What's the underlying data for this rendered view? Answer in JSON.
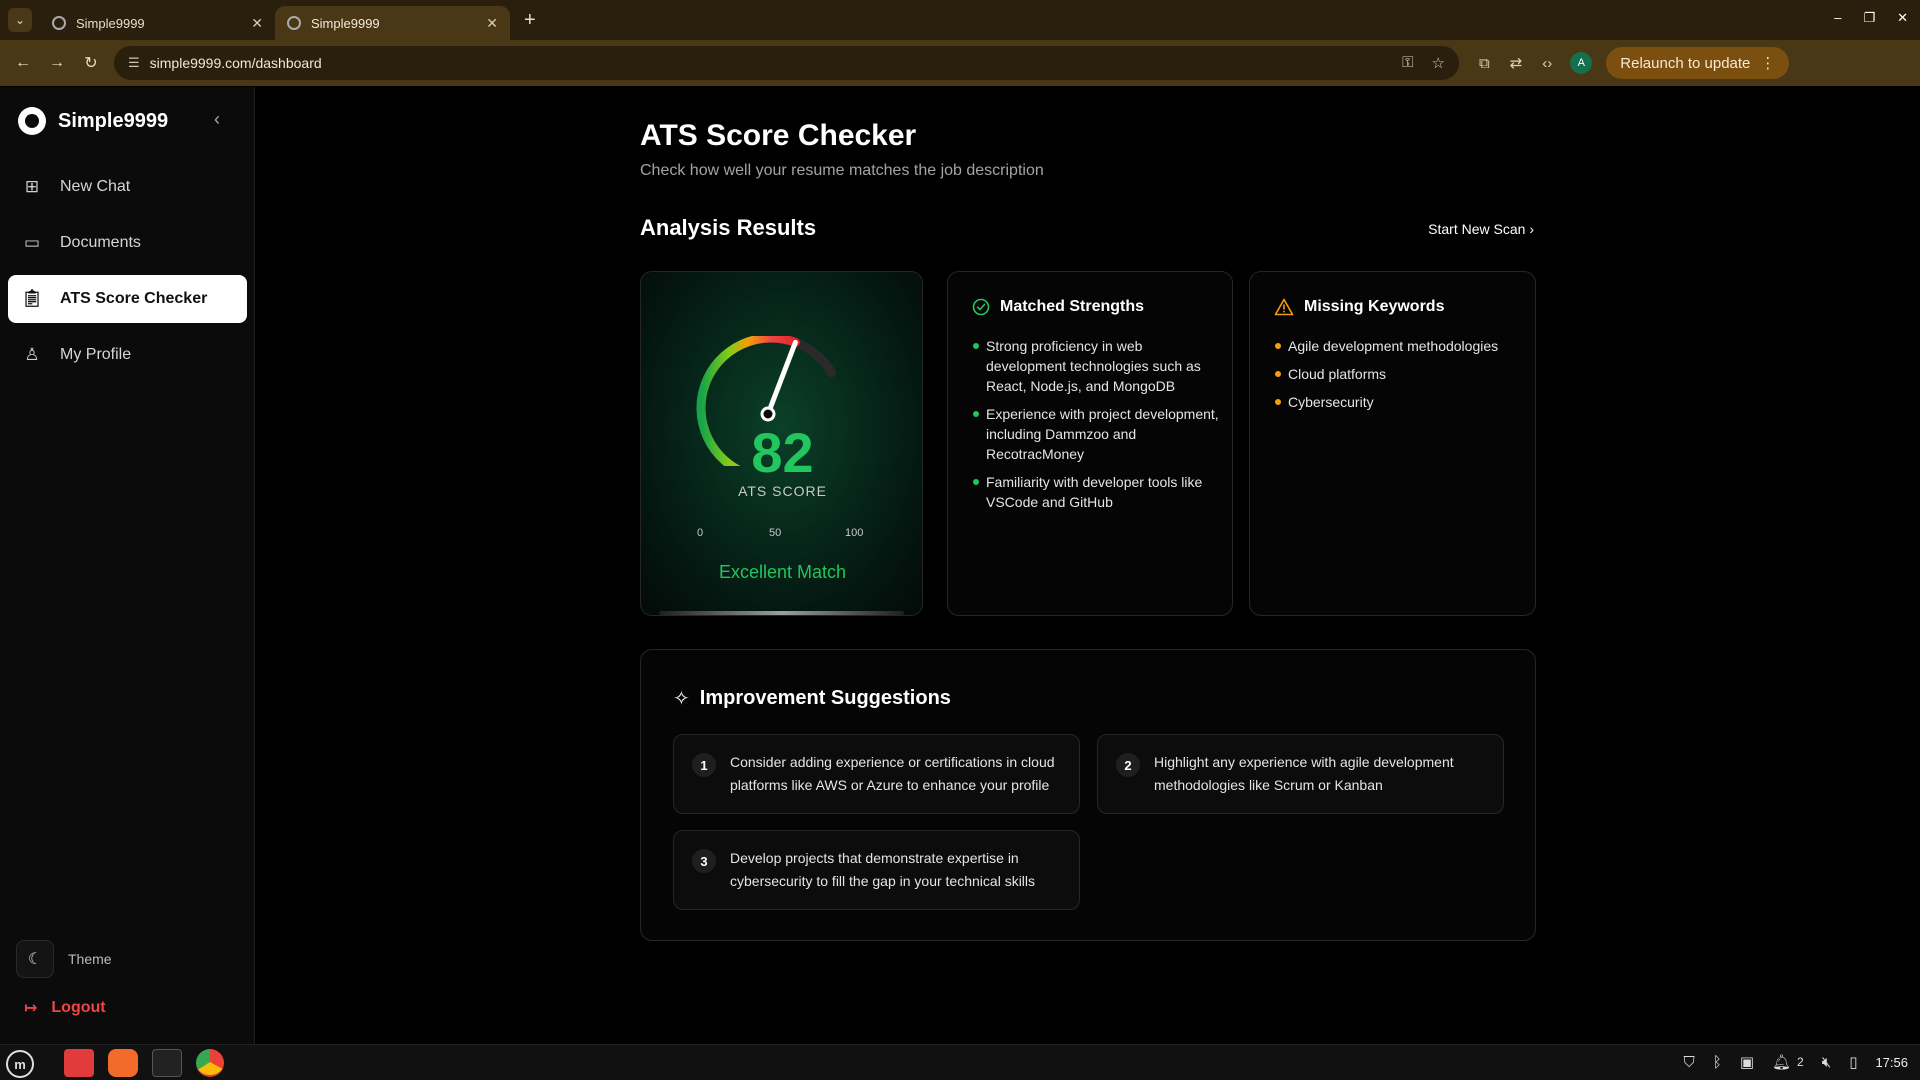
{
  "browser": {
    "tabs": [
      {
        "title": "Simple9999",
        "active": false
      },
      {
        "title": "Simple9999",
        "active": true
      }
    ],
    "url": "simple9999.com/dashboard",
    "relaunch_label": "Relaunch to update",
    "profile_initial": "A"
  },
  "sidebar": {
    "brand": "Simple9999",
    "items": [
      {
        "label": "New Chat",
        "icon": "new-chat-icon"
      },
      {
        "label": "Documents",
        "icon": "folder-icon"
      },
      {
        "label": "ATS Score Checker",
        "icon": "clipboard-icon",
        "active": true
      },
      {
        "label": "My Profile",
        "icon": "user-icon"
      }
    ],
    "theme_label": "Theme",
    "logout_label": "Logout"
  },
  "page": {
    "title": "ATS Score Checker",
    "subtitle": "Check how well your resume matches the job description",
    "section_title": "Analysis Results",
    "new_scan_label": "Start New Scan"
  },
  "score": {
    "value": 82,
    "max": 100,
    "label": "ATS SCORE",
    "ticks": [
      "0",
      "50",
      "100"
    ],
    "verdict": "Excellent Match",
    "accent": "#22c55e"
  },
  "strengths": {
    "title": "Matched Strengths",
    "items": [
      "Strong proficiency in web development technologies such as React, Node.js, and MongoDB",
      "Experience with project development, including Dammzoo and RecotracMoney",
      "Familiarity with developer tools like VSCode and GitHub"
    ]
  },
  "missing": {
    "title": "Missing Keywords",
    "items": [
      "Agile development methodologies",
      "Cloud platforms",
      "Cybersecurity"
    ]
  },
  "improvements": {
    "title": "Improvement Suggestions",
    "items": [
      {
        "num": "1",
        "text": "Consider adding experience or certifications in cloud platforms like AWS or Azure to enhance your profile"
      },
      {
        "num": "2",
        "text": "Highlight any experience with agile development methodologies like Scrum or Kanban"
      },
      {
        "num": "3",
        "text": "Develop projects that demonstrate expertise in cybersecurity to fill the gap in your technical skills"
      }
    ]
  },
  "taskbar": {
    "clock": "17:56",
    "notification_count": "2"
  }
}
